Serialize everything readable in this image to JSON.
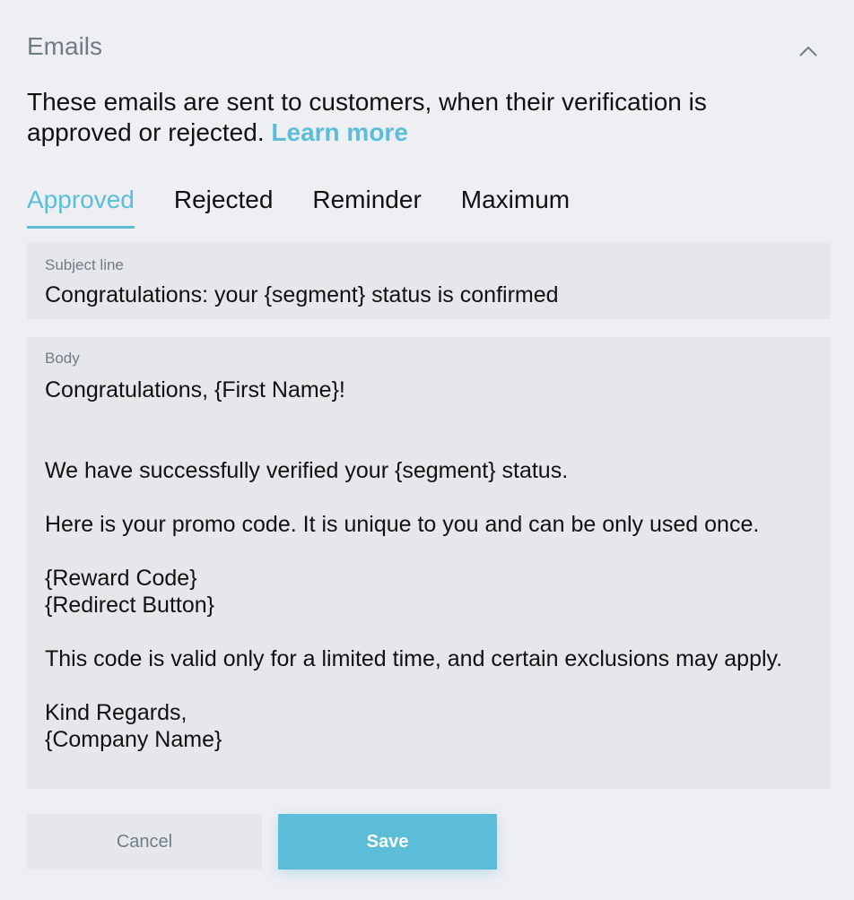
{
  "section": {
    "title": "Emails",
    "collapse_icon": "chevron-up-icon"
  },
  "description": {
    "text": "These emails are sent to customers, when their verification is approved or rejected.",
    "link_label": "Learn more"
  },
  "tabs": [
    {
      "label": "Approved",
      "active": true
    },
    {
      "label": "Rejected",
      "active": false
    },
    {
      "label": "Reminder",
      "active": false
    },
    {
      "label": "Maximum",
      "active": false
    }
  ],
  "subject": {
    "label": "Subject line",
    "value": "Congratulations: your {segment} status is confirmed"
  },
  "body": {
    "label": "Body",
    "lines": [
      "Congratulations, {First Name}!",
      "",
      "",
      "We have successfully verified your {segment} status.",
      "",
      "Here is your promo code. It is unique to you and can be only used once.",
      "",
      "{Reward Code}",
      "{Redirect Button}",
      "",
      "This code is valid only for a limited time, and certain exclusions may apply.",
      "",
      "Kind Regards,",
      "{Company Name}"
    ]
  },
  "actions": {
    "cancel_label": "Cancel",
    "save_label": "Save"
  },
  "colors": {
    "accent": "#5bbdd8",
    "muted": "#6f7d86",
    "background": "#eeeff3",
    "field_background": "#e6e7eb"
  }
}
